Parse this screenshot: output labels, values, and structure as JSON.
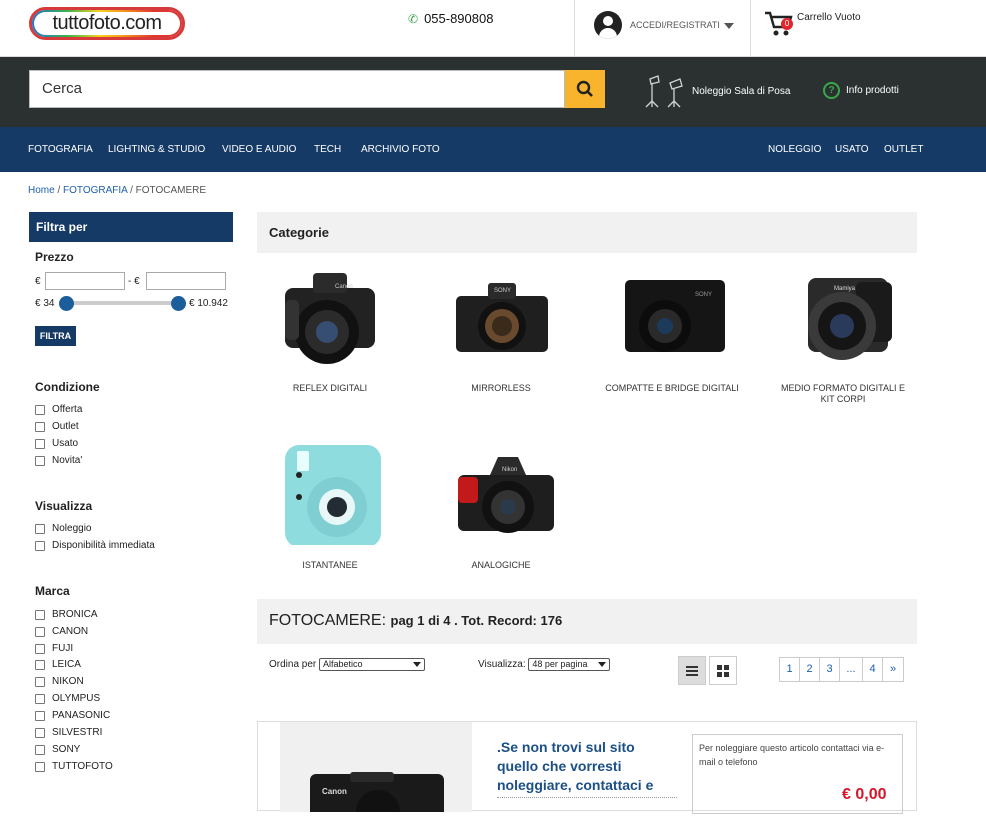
{
  "header": {
    "logo_text": "tuttofoto.com",
    "phone": "055-890808",
    "account_label": "ACCEDI/REGISTRATI",
    "cart_count": "0",
    "cart_label": "Carrello Vuoto"
  },
  "search": {
    "placeholder": "Cerca",
    "links": {
      "studio": "Noleggio Sala di Posa",
      "info": "Info prodotti"
    }
  },
  "nav": {
    "left": [
      "FOTOGRAFIA",
      "LIGHTING & STUDIO",
      "VIDEO E AUDIO",
      "TECH",
      "ARCHIVIO FOTO"
    ],
    "right": [
      "NOLEGGIO",
      "USATO",
      "OUTLET"
    ]
  },
  "breadcrumb": {
    "home": "Home",
    "sep": " / ",
    "cat": "FOTOGRAFIA",
    "current": "FOTOCAMERE"
  },
  "sidebar": {
    "title": "Filtra per",
    "price": {
      "title": "Prezzo",
      "currency": "€",
      "separator": "- €",
      "min_label": "€ 34",
      "max_label": "€ 10.942",
      "button": "FILTRA"
    },
    "condizione": {
      "title": "Condizione",
      "options": [
        "Offerta",
        "Outlet",
        "Usato",
        "Novita'"
      ]
    },
    "visualizza": {
      "title": "Visualizza",
      "options": [
        "Noleggio",
        "Disponibilità immediata"
      ]
    },
    "marca": {
      "title": "Marca",
      "options": [
        "BRONICA",
        "CANON",
        "FUJI",
        "LEICA",
        "NIKON",
        "OLYMPUS",
        "PANASONIC",
        "SILVESTRI",
        "SONY",
        "TUTTOFOTO"
      ]
    }
  },
  "categories": {
    "title": "Categorie",
    "items": [
      {
        "label": "REFLEX DIGITALI",
        "icon": "dslr-camera-icon"
      },
      {
        "label": "MIRRORLESS",
        "icon": "mirrorless-camera-icon"
      },
      {
        "label": "COMPATTE E BRIDGE DIGITALI",
        "icon": "compact-camera-icon"
      },
      {
        "label": "MEDIO FORMATO DIGITALI E KIT CORPI",
        "icon": "medium-format-camera-icon"
      },
      {
        "label": "ISTANTANEE",
        "icon": "instant-camera-icon"
      },
      {
        "label": "ANALOGICHE",
        "icon": "film-camera-icon"
      }
    ]
  },
  "listing": {
    "title": "FOTOCAMERE:",
    "summary": "pag 1 di 4 . Tot. Record: 176",
    "sort_label": "Ordina per",
    "sort_value": "Alfabetico",
    "view_label": "Visualizza:",
    "view_value": "48 per pagina",
    "pages": [
      "1",
      "2",
      "3",
      "...",
      "4",
      "»"
    ]
  },
  "product": {
    "message": ".Se non trovi sul sito quello che vorresti noleggiare, contattaci e",
    "rent_note": "Per noleggiare questo articolo contattaci via e-mail o telefono",
    "price": "€ 0,00",
    "brand_mark": "Canon"
  },
  "colors": {
    "nav": "#163a66",
    "search_bar": "#2b3131",
    "accent": "#f7b42c",
    "price": "#d6172b",
    "link": "#1e5fae"
  }
}
